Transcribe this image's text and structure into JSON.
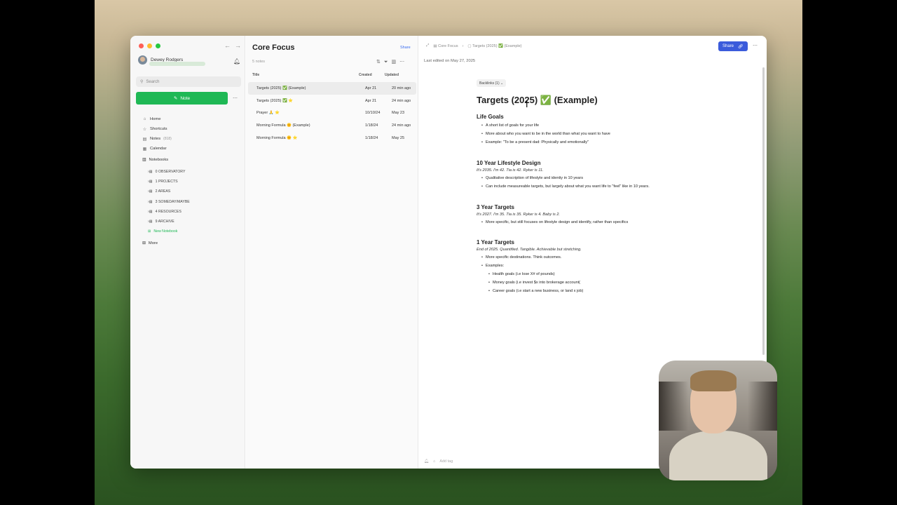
{
  "sidebar": {
    "user_name": "Dewey Rodgers",
    "search_placeholder": "Search",
    "note_button": "Note",
    "nav": [
      {
        "label": "Home",
        "icon": "home-icon"
      },
      {
        "label": "Shortcuts",
        "icon": "star-icon"
      },
      {
        "label": "Notes",
        "extra": "(818)",
        "icon": "note-icon"
      },
      {
        "label": "Calendar",
        "icon": "calendar-icon"
      }
    ],
    "notebooks_label": "Notebooks",
    "notebooks": [
      "0 OBSERVATORY",
      "1 PROJECTS",
      "2 AREAS",
      "3 SOMEDAY/MAYBE",
      "4 RESOURCES",
      "9 ARCHIVE"
    ],
    "new_notebook": "New Notebook",
    "more": "More"
  },
  "list": {
    "title": "Core Focus",
    "share": "Share",
    "count": "5 notes",
    "columns": {
      "title": "Title",
      "created": "Created",
      "updated": "Updated"
    },
    "rows": [
      {
        "title": "Targets (2025) ✅ (Example)",
        "created": "Apr 21",
        "updated": "20 min ago"
      },
      {
        "title": "Targets (2025) ✅ ⭐",
        "created": "Apr 21",
        "updated": "24 min ago"
      },
      {
        "title": "Prayer 🙏 ⭐",
        "created": "10/10/24",
        "updated": "May 23"
      },
      {
        "title": "Morning Formula 🌞 (Example)",
        "created": "1/18/24",
        "updated": "24 min ago"
      },
      {
        "title": "Morning Formula 🌞 ⭐",
        "created": "1/18/24",
        "updated": "May 25"
      }
    ]
  },
  "editor": {
    "crumb_notebook": "Core Focus",
    "crumb_note": "Targets (2025) ✅ (Example)",
    "share": "Share",
    "last_edited": "Last edited on May 27, 2025",
    "backlinks": "Backlinks (1)",
    "title": "Targets (2025) ✅ (Example)",
    "sections": {
      "s1": {
        "heading": "Life Goals",
        "items": [
          "A short list of goals for your life",
          "More about who you want to be in the world than what you want to have",
          "Example: \"To be a present dad: Physically and emotionally\""
        ]
      },
      "s2": {
        "heading": "10 Year Lifestyle Design",
        "italic": "It's 2035. I'm 42. Tia is 42. Ryker is 11.",
        "items": [
          "Qualitative description of lifestyle and identiy in 10 years",
          "Can include measureable targets, but largely about what you want life to \"feel\" like in 10 years."
        ]
      },
      "s3": {
        "heading": "3 Year Targets",
        "italic": "It's 2027. I'm 35. Tia is 35. Ryker is 4. Baby is 2.",
        "items": [
          "More specific, but still focuses on lifestyle design and identify, rather than specifics"
        ]
      },
      "s4": {
        "heading": "1 Year Targets",
        "italic": "End of 2025. Quantified. Tangible. Achievable but stretching.",
        "items": [
          "More specific destinations. Think outcomes.",
          "Examples:"
        ],
        "sub": [
          "Health goals (i.e lose X# of pounds)",
          "Money goals (i.e invest $x into brokerage account(",
          "Career goals (i.e start a new business, or land x job)"
        ]
      }
    },
    "add_tag": "Add tag"
  }
}
